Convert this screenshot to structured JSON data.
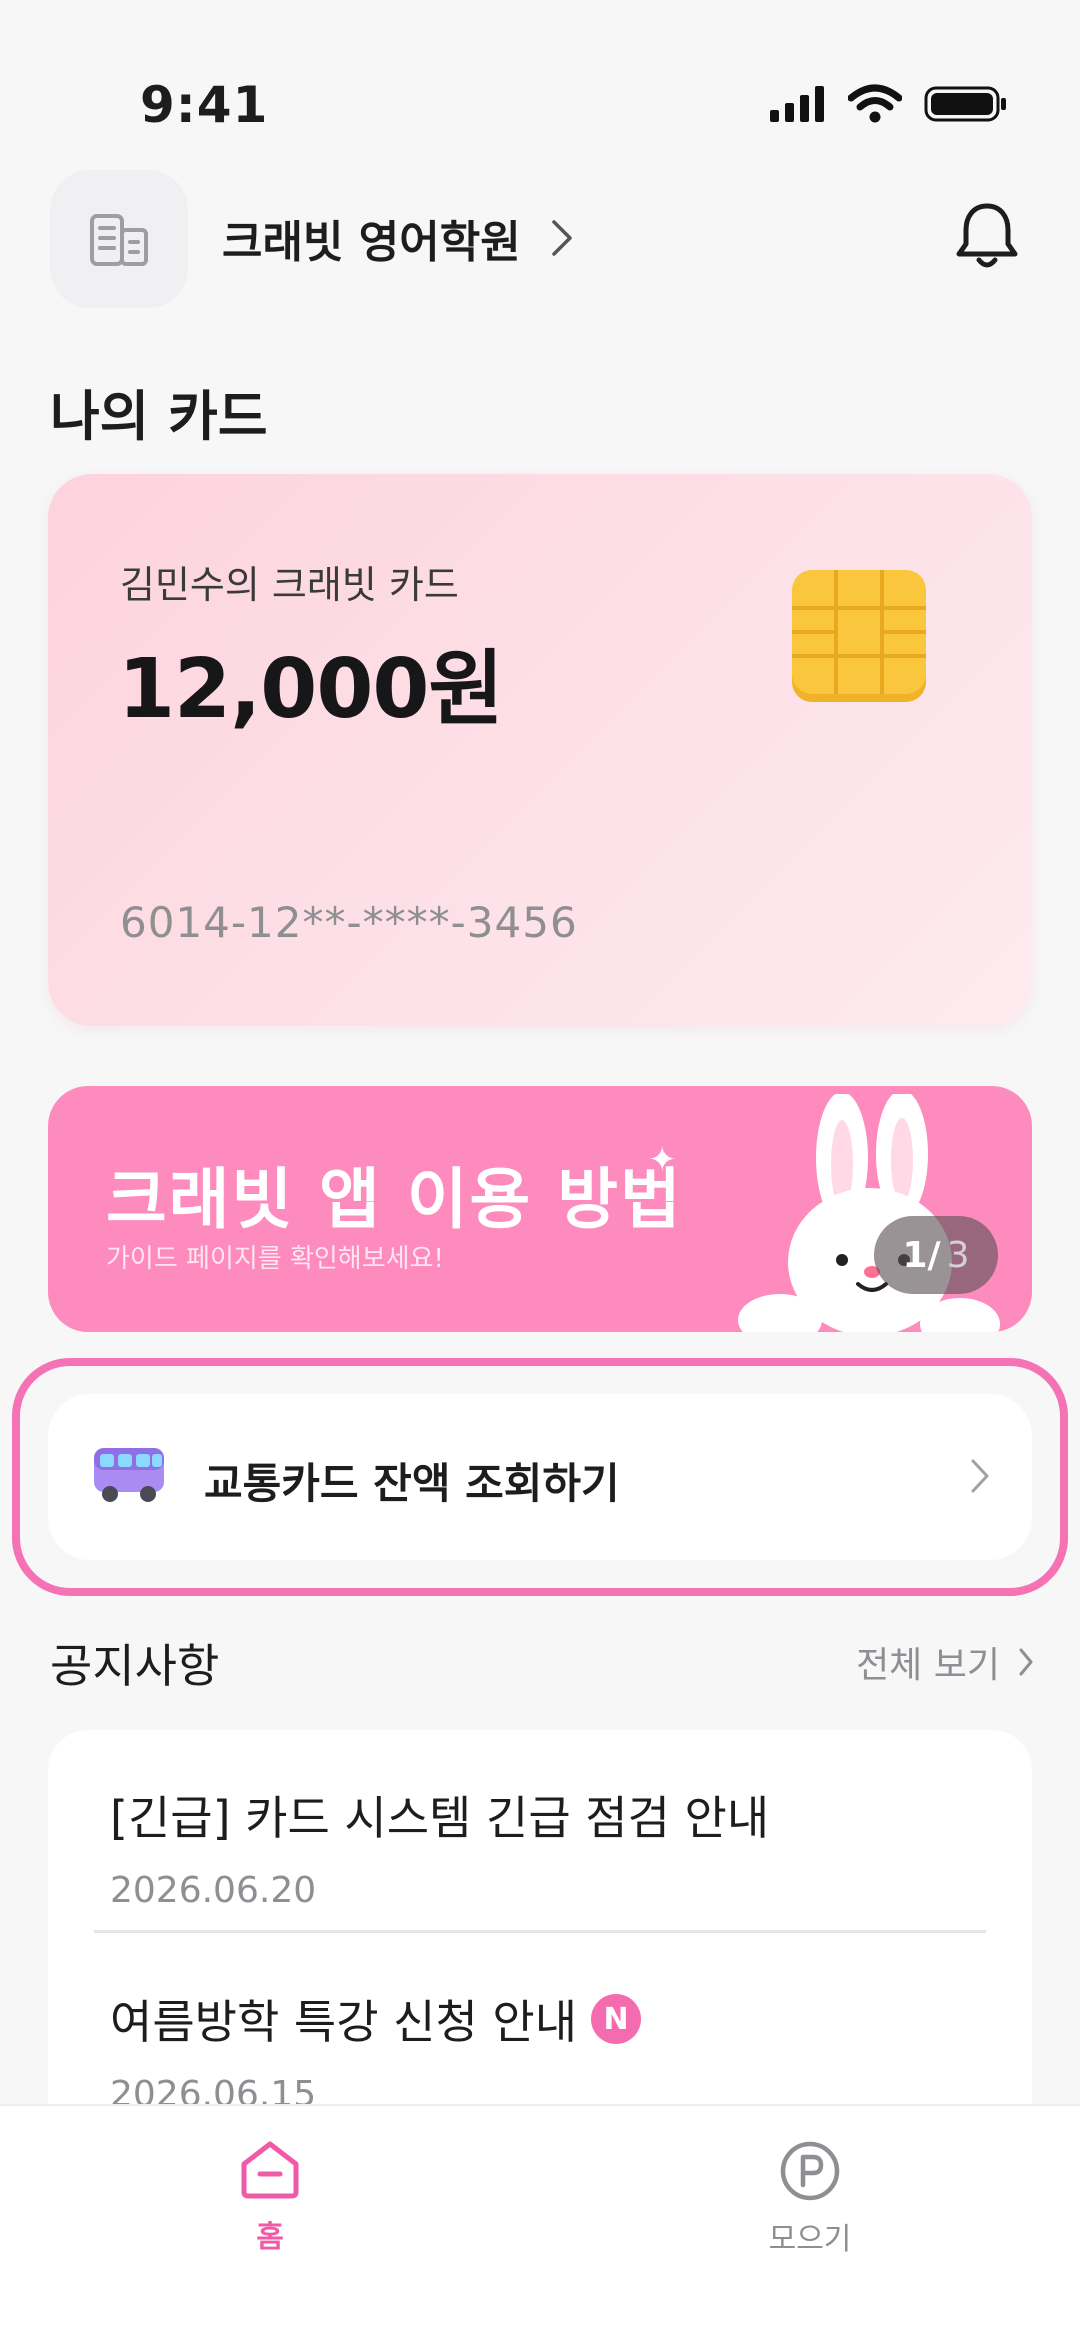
{
  "status_bar": {
    "time": "9:41"
  },
  "header": {
    "org_name": "크래빗 영어학원"
  },
  "my_card_section": {
    "title": "나의 카드"
  },
  "card": {
    "owner": "김민수의 크래빗 카드",
    "balance": "12,000원",
    "number": "6014-12**-****-3456",
    "colors": {
      "gradient_start": "#fdd3dd",
      "gradient_end": "#fdeaef",
      "chip": "#f9c63d"
    }
  },
  "banner": {
    "title": "크래빗 앱 이용 방법",
    "subtitle": "가이드 페이지를 확인해보세요!",
    "pager_current": "1/",
    "pager_total": "3",
    "color": "#fe8bbd"
  },
  "transit": {
    "label": "교통카드 잔액 조회하기",
    "icon": "bus-icon",
    "highlight_color": "#f573b5"
  },
  "notices": {
    "title": "공지사항",
    "view_all": "전체 보기",
    "items": [
      {
        "title": "[긴급] 카드 시스템 긴급 점검 안내",
        "date": "2026.06.20",
        "is_new": false
      },
      {
        "title": "여름방학 특강 신청 안내",
        "date": "2026.06.15",
        "is_new": true,
        "badge": "N"
      }
    ]
  },
  "bottom_nav": {
    "items": [
      {
        "label": "홈",
        "icon": "home-icon",
        "active": true
      },
      {
        "label": "모으기",
        "icon": "points-icon",
        "active": false
      }
    ],
    "active_color": "#f15aa7"
  }
}
